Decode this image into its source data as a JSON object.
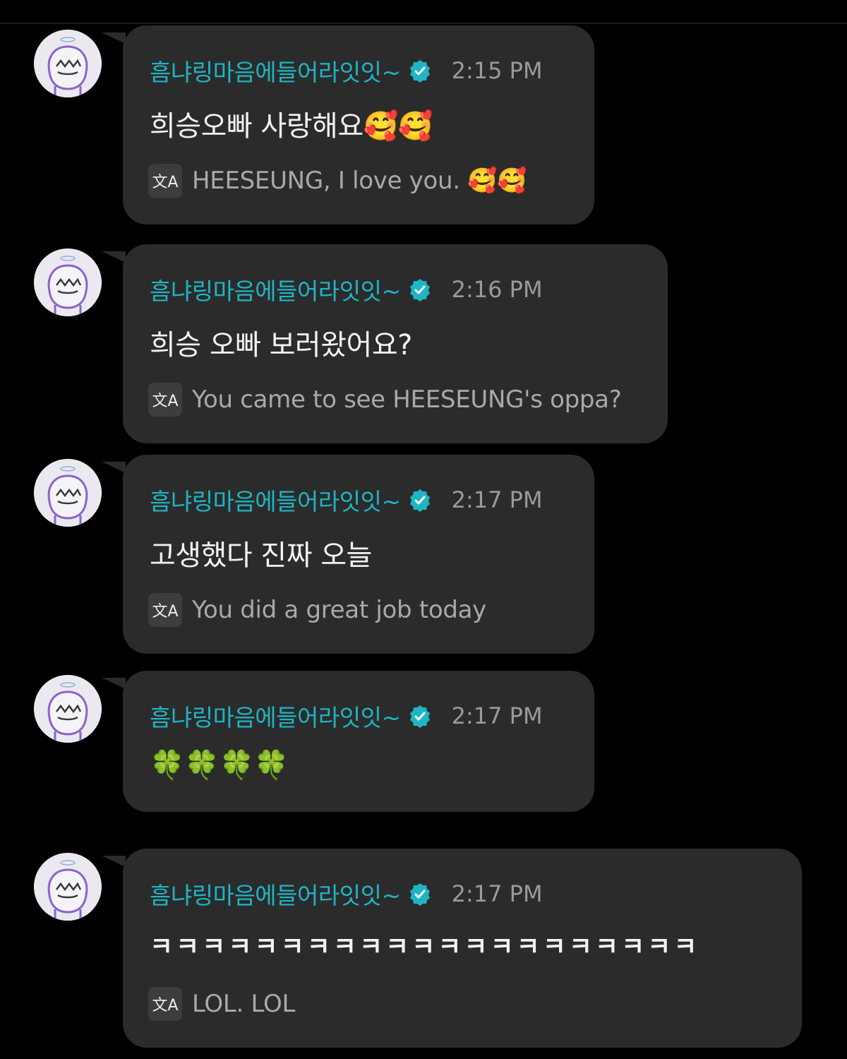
{
  "accent_color": "#1fb5c4",
  "bubble_color": "#2b2b2b",
  "translate_icon_glyph": "文A",
  "messages": [
    {
      "username": "흠냐링마음에들어라잇잇~",
      "time": "2:15 PM",
      "text": "희승오빠 사랑해요🥰🥰",
      "translation": "HEESEUNG, I love you. 🥰🥰"
    },
    {
      "username": "흠냐링마음에들어라잇잇~",
      "time": "2:16 PM",
      "text": "희승 오빠 보러왔어요?",
      "translation": "You came to see HEESEUNG's oppa?"
    },
    {
      "username": "흠냐링마음에들어라잇잇~",
      "time": "2:17 PM",
      "text": "고생했다 진짜 오늘",
      "translation": "You did a great job today"
    },
    {
      "username": "흠냐링마음에들어라잇잇~",
      "time": "2:17 PM",
      "text": "🍀🍀🍀🍀",
      "translation": ""
    },
    {
      "username": "흠냐링마음에들어라잇잇~",
      "time": "2:17 PM",
      "text": "ㅋㅋㅋㅋㅋㅋㅋㅋㅋㅋㅋㅋㅋㅋㅋㅋㅋㅋㅋㅋㅋ",
      "translation": "LOL. LOL"
    }
  ]
}
